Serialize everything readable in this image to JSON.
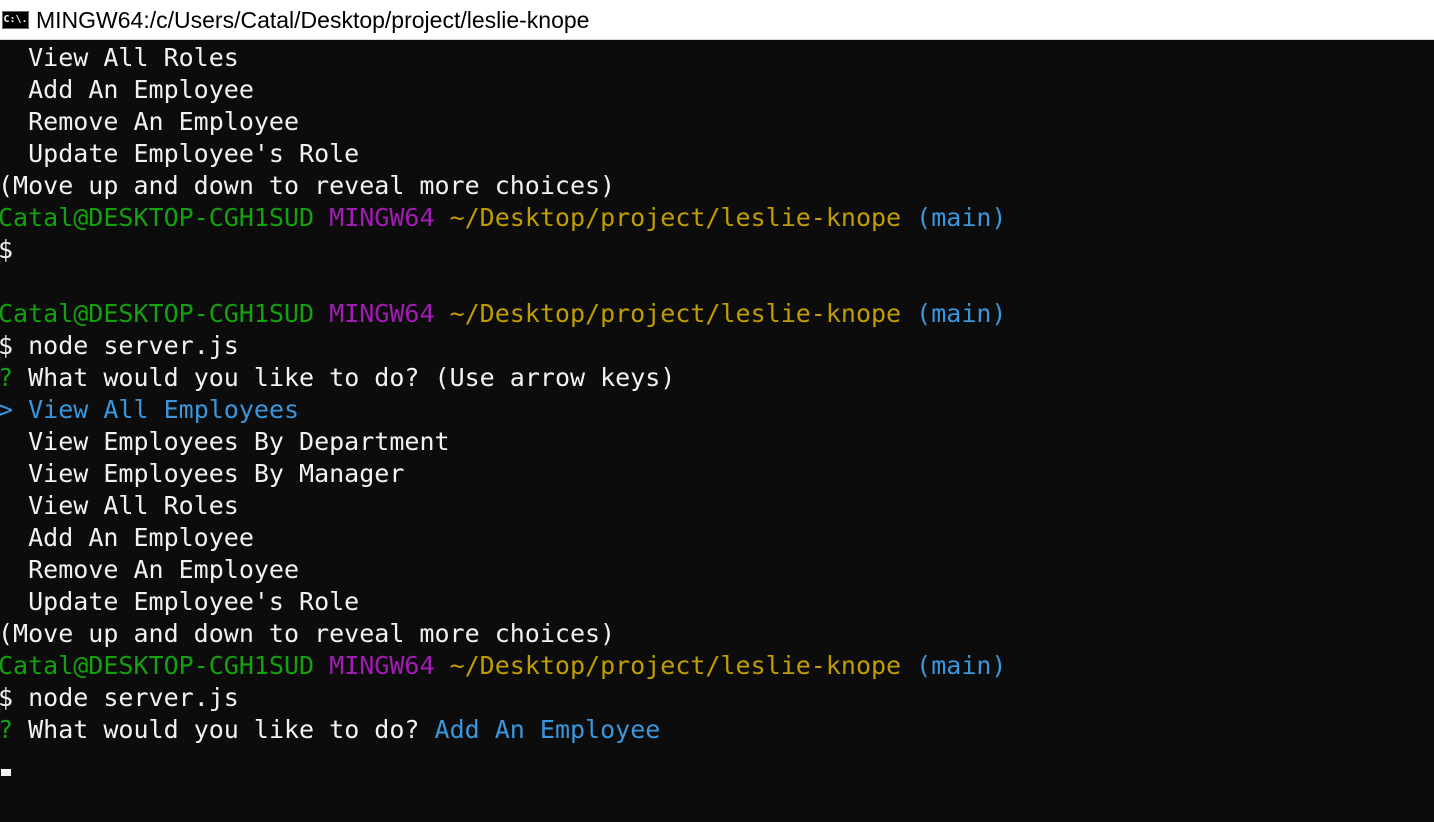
{
  "window": {
    "title": "MINGW64:/c/Users/Catal/Desktop/project/leslie-knope",
    "icon_text": "C:\\."
  },
  "colors": {
    "background": "#0c0c0c",
    "foreground": "#cccccc",
    "user_host": "#13a10e",
    "msystem": "#a31bb5",
    "path": "#c19c00",
    "branch": "#3a96dd",
    "selected": "#3a96dd"
  },
  "terminal": {
    "prompt": {
      "user_host": "Catal@DESKTOP-CGH1SUD",
      "msystem": "MINGW64",
      "path": "~/Desktop/project/leslie-knope",
      "branch": "(main)",
      "symbol": "$"
    },
    "top_menu": {
      "items": [
        "View All Roles",
        "Add An Employee",
        "Remove An Employee",
        "Update Employee's Role"
      ],
      "hint": "(Move up and down to reveal more choices)"
    },
    "command": "node server.js",
    "question_mark": "?",
    "question": "What would you like to do?",
    "question_hint": "(Use arrow keys)",
    "pointer": ">",
    "menu": {
      "selected": "View All Employees",
      "items": [
        "View Employees By Department",
        "View Employees By Manager",
        "View All Roles",
        "Add An Employee",
        "Remove An Employee",
        "Update Employee's Role"
      ],
      "hint": "(Move up and down to reveal more choices)"
    },
    "answer": "Add An Employee",
    "cursor": "cursor-block"
  }
}
